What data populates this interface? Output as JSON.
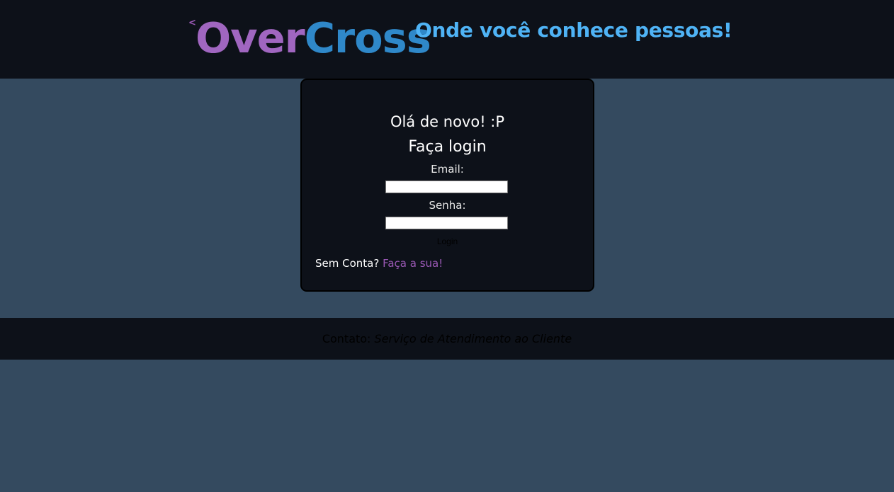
{
  "header": {
    "logo_back": "<",
    "logo_part1": "Over",
    "logo_part2": "Cross",
    "tagline": "Onde você conhece pessoas!"
  },
  "login_card": {
    "greeting": "Olá de novo! :P",
    "title": "Faça login",
    "email_label": "Email:",
    "email_value": "",
    "password_label": "Senha:",
    "password_value": "",
    "login_button": "Login",
    "no_account_text": "Sem Conta?",
    "signup_link": "Faça a sua!"
  },
  "footer": {
    "contact_label": "Contato:",
    "contact_link": "Serviço de Atendimento ao Cliente"
  },
  "colors": {
    "page_bg": "#344a5f",
    "bar_bg": "#0d1119",
    "logo_purple": "#a066c0",
    "logo_blue": "#2f88c9",
    "tagline_blue": "#4fb3f5",
    "link_purple": "#9b59b6"
  }
}
